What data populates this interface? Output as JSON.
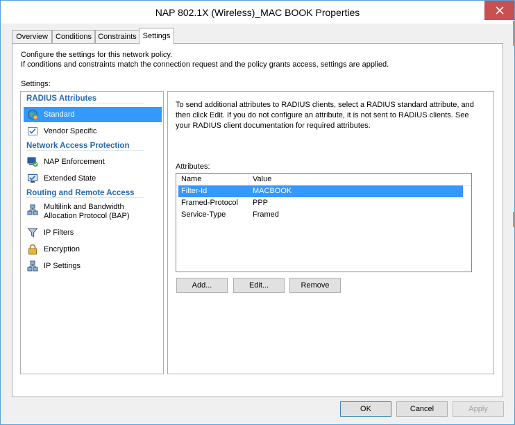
{
  "window": {
    "title": "NAP 802.1X (Wireless)_MAC BOOK Properties",
    "close_label": "✕"
  },
  "tabs": [
    {
      "label": "Overview"
    },
    {
      "label": "Conditions"
    },
    {
      "label": "Constraints"
    },
    {
      "label": "Settings",
      "active": true
    }
  ],
  "description": {
    "line1": "Configure the settings for this network policy.",
    "line2": "If conditions and constraints match the connection request and the policy grants access, settings are applied."
  },
  "settings_label": "Settings:",
  "left_nav": {
    "sections": [
      {
        "header": "RADIUS Attributes",
        "items": [
          {
            "label": "Standard",
            "icon": "globe-icon",
            "selected": true
          },
          {
            "label": "Vendor Specific",
            "icon": "checklist-icon"
          }
        ]
      },
      {
        "header": "Network Access Protection",
        "items": [
          {
            "label": "NAP Enforcement",
            "icon": "nap-enforcement-icon"
          },
          {
            "label": "Extended State",
            "icon": "monitor-check-icon"
          }
        ]
      },
      {
        "header": "Routing and Remote Access",
        "items": [
          {
            "label_line1": "Multilink and Bandwidth",
            "label_line2": "Allocation Protocol (BAP)",
            "icon": "network-icon"
          },
          {
            "label": "IP Filters",
            "icon": "funnel-icon"
          },
          {
            "label": "Encryption",
            "icon": "padlock-icon"
          },
          {
            "label": "IP Settings",
            "icon": "network-icon"
          }
        ]
      }
    ]
  },
  "right_pane": {
    "description_line1": "To send additional attributes to RADIUS clients, select a RADIUS standard attribute, and",
    "description_line2": "then click Edit. If you do not configure an attribute, it is not sent to RADIUS clients. See",
    "description_line3": "your RADIUS client documentation for required attributes.",
    "attributes_label": "Attributes:",
    "columns": [
      "Name",
      "Value"
    ],
    "rows": [
      {
        "name": "Filter-Id",
        "value": "MACBOOK",
        "selected": true
      },
      {
        "name": "Framed-Protocol",
        "value": "PPP"
      },
      {
        "name": "Service-Type",
        "value": "Framed"
      }
    ],
    "buttons": {
      "add": "Add...",
      "edit": "Edit...",
      "remove": "Remove"
    }
  },
  "footer_buttons": {
    "ok": "OK",
    "cancel": "Cancel",
    "apply": "Apply"
  },
  "colors": {
    "selection": "#3399ff",
    "section_header": "#2a6ab0",
    "close_button": "#c75050"
  }
}
